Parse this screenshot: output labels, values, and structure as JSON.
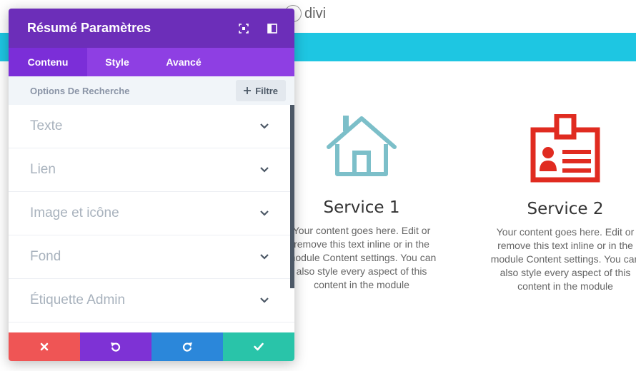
{
  "site": {
    "logo_text": "divi"
  },
  "colors": {
    "panel_header": "#6c2eb9",
    "tabs_bar": "#8e3fe3",
    "active_tab": "#7b2ed8",
    "cyan_bar": "#1ec6e2",
    "cancel": "#ef5555",
    "undo": "#7e32d5",
    "redo": "#2b87da",
    "save": "#29c4a9",
    "service_1_icon": "#7cbfc9",
    "service_2_icon": "#e02b20"
  },
  "panel": {
    "title": "Résumé Paramètres",
    "header_icons": [
      "expand-icon",
      "sidebar-layout-icon"
    ],
    "tabs": [
      {
        "label": "Contenu",
        "active": true
      },
      {
        "label": "Style",
        "active": false
      },
      {
        "label": "Avancé",
        "active": false
      }
    ],
    "search": {
      "label": "Options De Recherche",
      "filter_label": "Filtre"
    },
    "sections": [
      {
        "label": "Texte"
      },
      {
        "label": "Lien"
      },
      {
        "label": "Image et icône"
      },
      {
        "label": "Fond"
      },
      {
        "label": "Étiquette Admin"
      }
    ],
    "footer_buttons": [
      {
        "name": "cancel-button",
        "icon": "close-icon"
      },
      {
        "name": "undo-button",
        "icon": "undo-icon"
      },
      {
        "name": "redo-button",
        "icon": "redo-icon"
      },
      {
        "name": "save-button",
        "icon": "check-icon"
      }
    ]
  },
  "services": [
    {
      "title": "Service 1",
      "icon": "house-icon",
      "text": [
        "Your content goes here. Edit or",
        "remove this text inline or in the",
        "module Content settings. You can",
        "also style every aspect of this",
        "content in the module"
      ]
    },
    {
      "title": "Service 2",
      "icon": "id-badge-icon",
      "text": [
        "Your content goes here. Edit or",
        "remove this text inline or in the",
        "module Content settings. You can",
        "also style every aspect of this",
        "content in the module"
      ]
    }
  ]
}
